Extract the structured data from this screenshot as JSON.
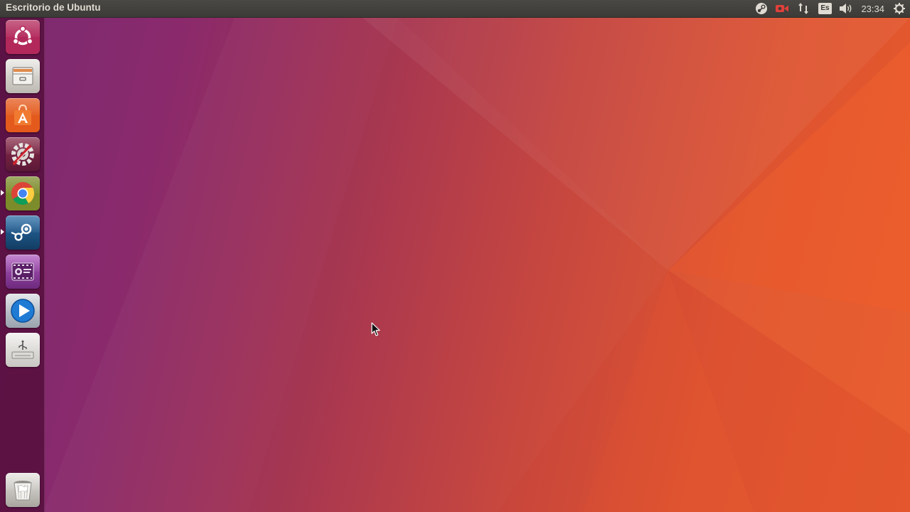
{
  "top_panel": {
    "title": "Escritorio de Ubuntu",
    "indicators": [
      {
        "icon": "steam-tray-icon"
      },
      {
        "icon": "video-camera-icon"
      },
      {
        "icon": "network-arrows-icon"
      },
      {
        "icon": "keyboard-layout-icon",
        "label": "Es"
      },
      {
        "icon": "volume-icon"
      },
      {
        "icon": "clock",
        "label": "23:34"
      },
      {
        "icon": "gear-icon"
      }
    ],
    "keyboard_layout": "Es",
    "clock": "23:34"
  },
  "launcher": {
    "items": [
      {
        "name": "ubuntu-dash",
        "icon": "ubuntu-logo-icon",
        "running": false
      },
      {
        "name": "files",
        "icon": "file-cabinet-icon",
        "running": false
      },
      {
        "name": "ubuntu-software",
        "icon": "software-bag-icon",
        "running": false
      },
      {
        "name": "system-settings",
        "icon": "settings-wrench-icon",
        "running": false
      },
      {
        "name": "chrome",
        "icon": "chrome-icon",
        "running": true
      },
      {
        "name": "steam",
        "icon": "steam-icon",
        "running": true
      },
      {
        "name": "screen-recorder",
        "icon": "film-recorder-icon",
        "running": false
      },
      {
        "name": "media-player",
        "icon": "play-icon",
        "running": false
      },
      {
        "name": "usb-drive",
        "icon": "usb-drive-icon",
        "running": false
      },
      {
        "name": "trash",
        "icon": "trash-icon",
        "running": false
      }
    ]
  },
  "colors": {
    "panel_bg": "#3c3b37",
    "launcher_bg": "#540e3a",
    "wallpaper_left": "#7b2a72",
    "wallpaper_right": "#e75a2c"
  }
}
